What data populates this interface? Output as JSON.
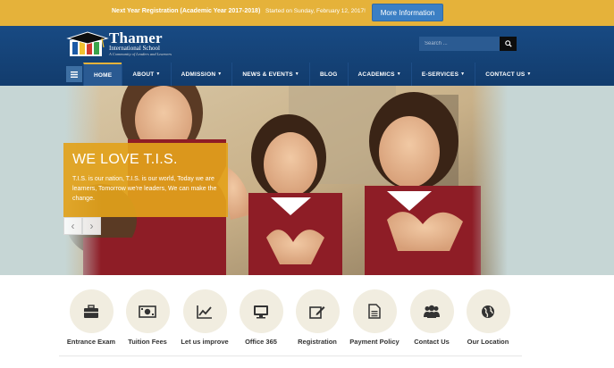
{
  "announcement": {
    "title": "Next Year Registration (Academic Year 2017-2018)",
    "date": "Started on Sunday, February 12, 2017!",
    "button": "More Information"
  },
  "logo": {
    "name": "Thamer",
    "subtitle": "International School",
    "tagline": "A Community of Leaders and Learners"
  },
  "search": {
    "placeholder": "Search ..."
  },
  "nav": {
    "items": [
      "HOME",
      "ABOUT",
      "ADMISSION",
      "NEWS & EVENTS",
      "BLOG",
      "ACADEMICS",
      "E-SERVICES",
      "CONTACT US"
    ],
    "active_index": 0
  },
  "hero": {
    "heading": "WE LOVE T.I.S.",
    "text": "T.I.S. is our nation, T.I.S. is our world, Today we are learners, Tomorrow we're leaders, We can make the change."
  },
  "quick_links": [
    {
      "label": "Entrance Exam",
      "icon": "briefcase-icon"
    },
    {
      "label": "Tuition Fees",
      "icon": "money-icon"
    },
    {
      "label": "Let us improve",
      "icon": "line-chart-icon"
    },
    {
      "label": "Office 365",
      "icon": "monitor-icon"
    },
    {
      "label": "Registration",
      "icon": "edit-icon"
    },
    {
      "label": "Payment Policy",
      "icon": "document-icon"
    },
    {
      "label": "Contact Us",
      "icon": "users-icon"
    },
    {
      "label": "Our Location",
      "icon": "globe-icon"
    }
  ],
  "colors": {
    "accent": "#e5b23a",
    "header": "#184a83",
    "button": "#3b7fc4",
    "caption": "#e2a21b"
  }
}
